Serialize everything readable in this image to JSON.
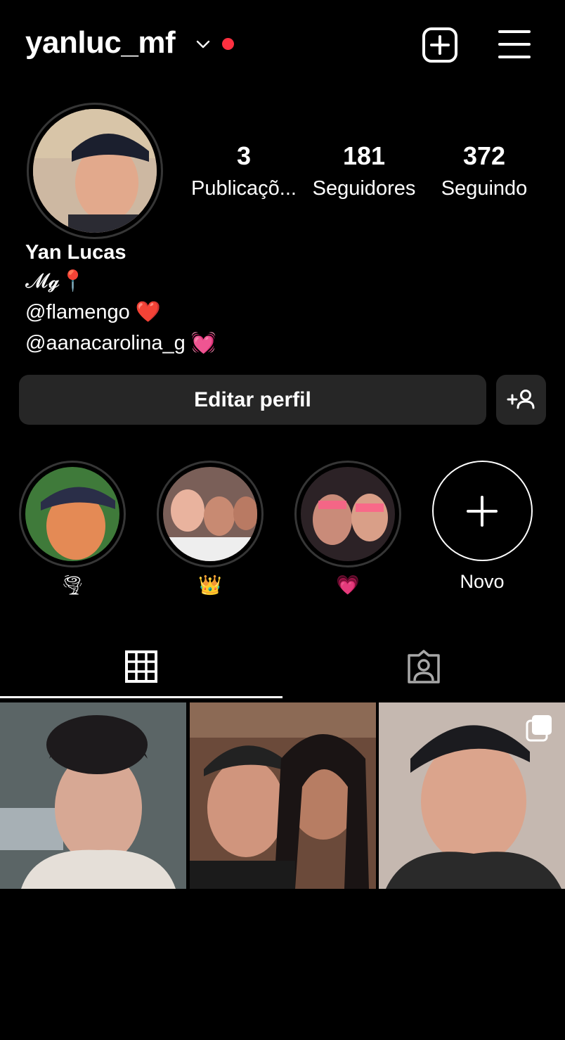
{
  "header": {
    "username": "yanluc_mf",
    "notification_dot_color": "#ff3040"
  },
  "profile": {
    "stats": [
      {
        "value": "3",
        "label": "Publicaçõ..."
      },
      {
        "value": "181",
        "label": "Seguidores"
      },
      {
        "value": "372",
        "label": "Seguindo"
      }
    ],
    "name": "Yan Lucas",
    "bio_lines": [
      "𝓜𝓰📍",
      "@flamengo ❤️",
      "@aanacarolina_g 💓"
    ]
  },
  "actions": {
    "edit_label": "Editar perfil"
  },
  "highlights": [
    {
      "label": "🌪"
    },
    {
      "label": "👑"
    },
    {
      "label": "💗"
    },
    {
      "label": "Novo"
    }
  ],
  "tabs": [
    {
      "icon": "grid-icon"
    },
    {
      "icon": "tagged-icon"
    }
  ],
  "colors": {
    "background": "#000000",
    "button": "#262626",
    "ring": "#363636"
  }
}
